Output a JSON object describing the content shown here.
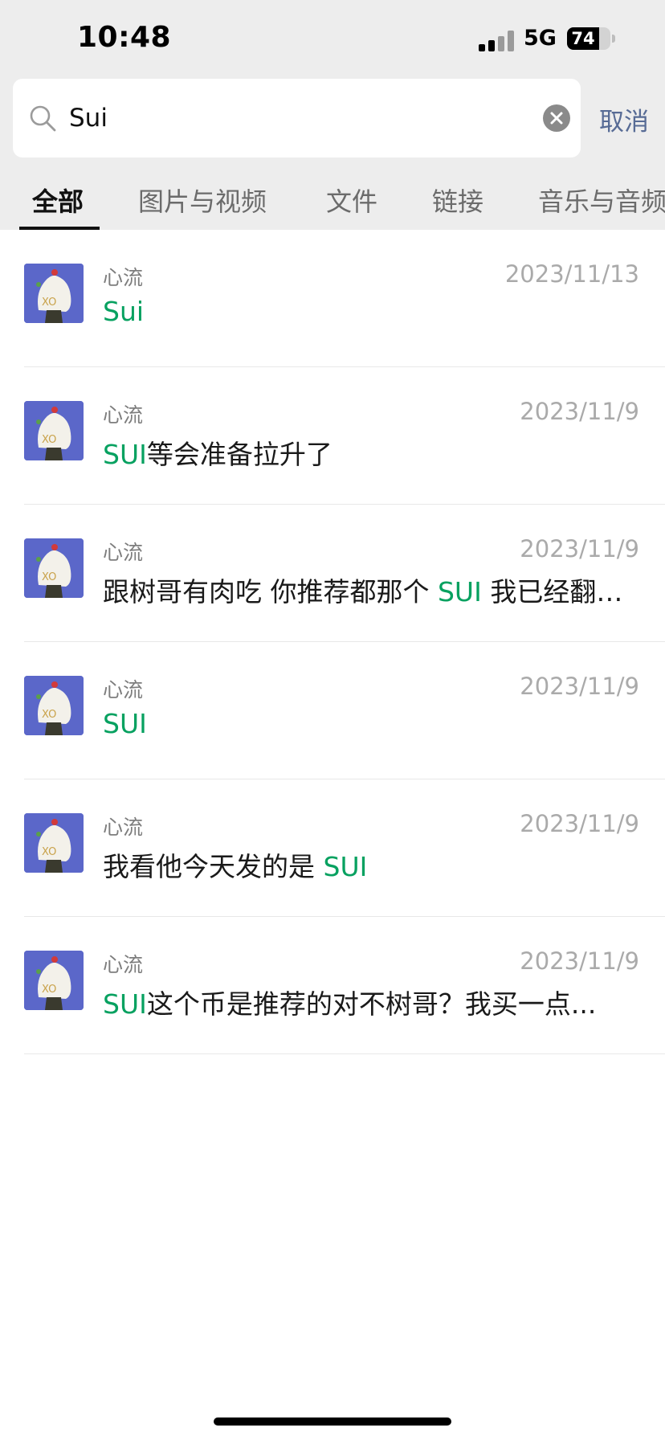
{
  "status_bar": {
    "time": "10:48",
    "network": "5G",
    "battery": "74",
    "battery_level": 0.74
  },
  "search": {
    "query": "Sui",
    "cancel_label": "取消"
  },
  "tabs": [
    {
      "label": "全部",
      "active": true
    },
    {
      "label": "图片与视频",
      "active": false
    },
    {
      "label": "文件",
      "active": false
    },
    {
      "label": "链接",
      "active": false
    },
    {
      "label": "音乐与音频",
      "active": false
    }
  ],
  "results": [
    {
      "sender": "心流",
      "date": "2023/11/13",
      "highlight": "Sui",
      "before": "",
      "after": ""
    },
    {
      "sender": "心流",
      "date": "2023/11/9",
      "highlight": "SUI",
      "before": "",
      "after": "等会准备拉升了"
    },
    {
      "sender": "心流",
      "date": "2023/11/9",
      "highlight": "SUI",
      "before": "跟树哥有肉吃 你推荐都那个 ",
      "after": " 我已经翻…"
    },
    {
      "sender": "心流",
      "date": "2023/11/9",
      "highlight": "SUI",
      "before": "",
      "after": ""
    },
    {
      "sender": "心流",
      "date": "2023/11/9",
      "highlight": "SUI",
      "before": "我看他今天发的是 ",
      "after": ""
    },
    {
      "sender": "心流",
      "date": "2023/11/9",
      "highlight": "SUI",
      "before": "",
      "after": "这个币是推荐的对不树哥？我买一点..."
    }
  ],
  "colors": {
    "highlight": "#07a160",
    "cancel": "#576b95",
    "avatar_bg": "#5b67c9"
  }
}
